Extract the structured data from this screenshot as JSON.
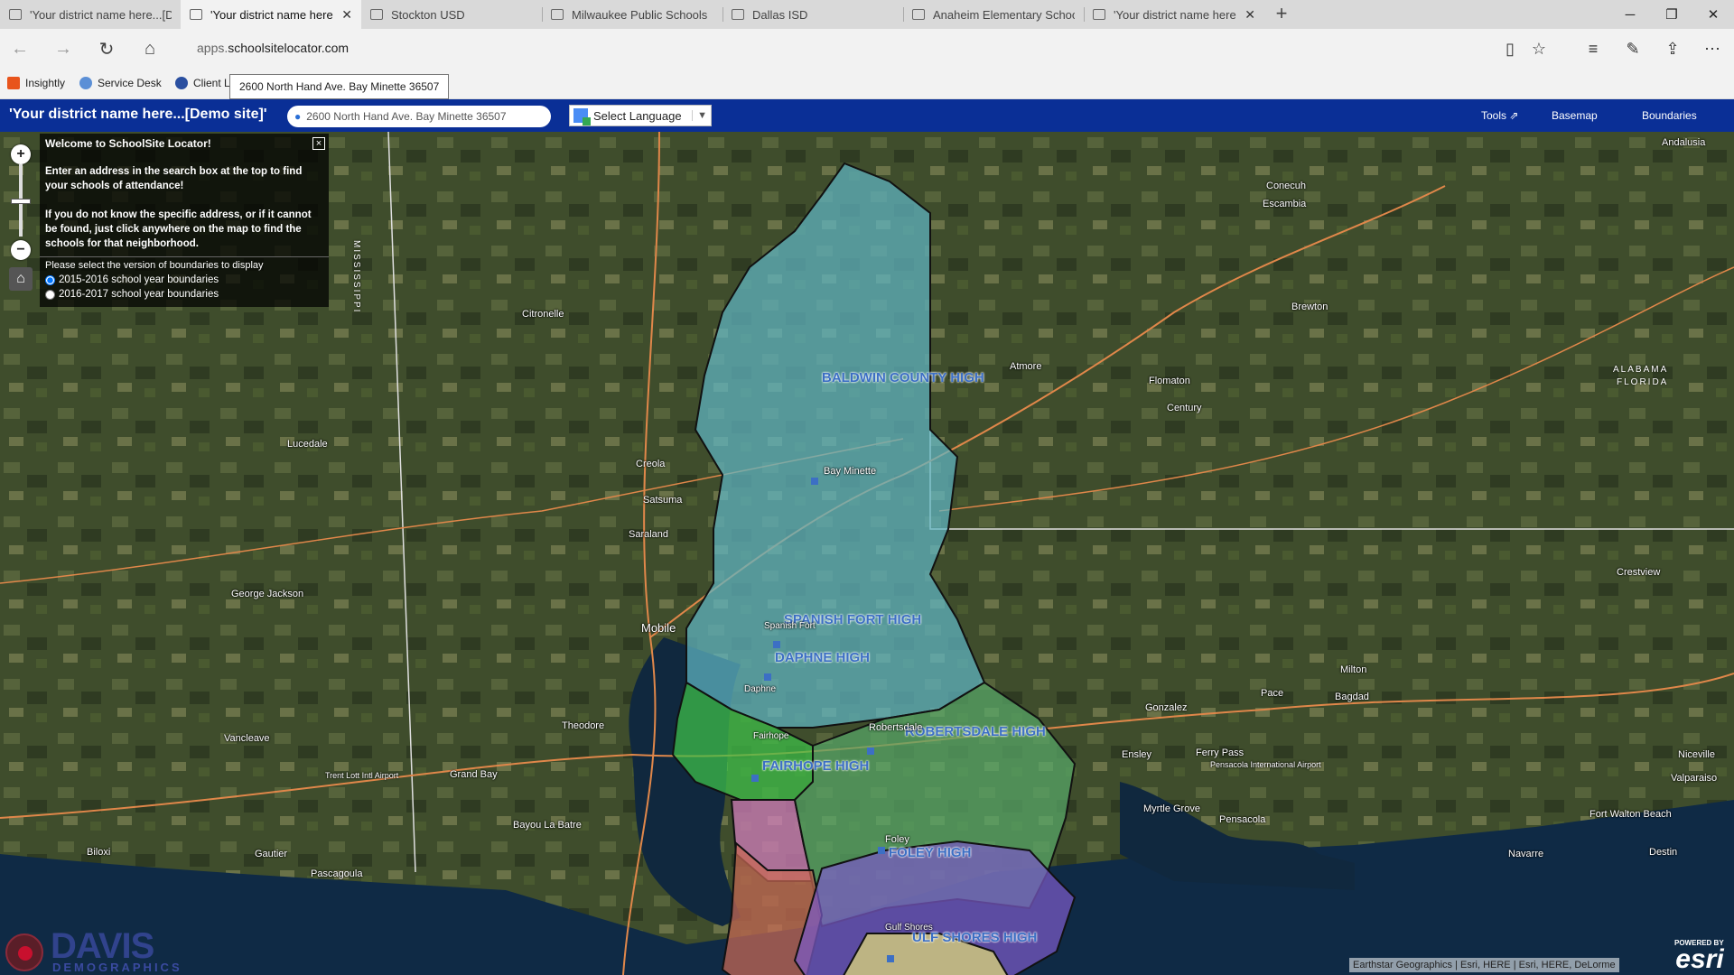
{
  "browser": {
    "tabs": [
      {
        "label": "'Your district name here...[D",
        "active": false,
        "closable": false
      },
      {
        "label": "'Your district name here",
        "active": true,
        "closable": true
      },
      {
        "label": "Stockton USD",
        "active": false,
        "closable": false
      },
      {
        "label": "Milwaukee Public Schools",
        "active": false,
        "closable": false
      },
      {
        "label": "Dallas ISD",
        "active": false,
        "closable": false
      },
      {
        "label": "Anaheim Elementary Schoo",
        "active": false,
        "closable": false
      },
      {
        "label": "'Your district name here",
        "active": false,
        "closable": true
      }
    ],
    "new_tab": "+",
    "url_prefix": "apps.",
    "url_domain": "schoolsitelocator.com",
    "favorites": [
      "Insightly",
      "Service Desk",
      "Client L"
    ],
    "tooltip": "2600 North Hand Ave. Bay Minette 36507"
  },
  "app": {
    "title": "'Your district name here...[Demo site]'",
    "search_value": "2600 North Hand Ave. Bay Minette 36507",
    "language_label": "Select Language",
    "tools_label": "Tools",
    "basemap_label": "Basemap",
    "boundaries_label": "Boundaries"
  },
  "welcome": {
    "title": "Welcome to SchoolSite Locator!",
    "para1": "Enter an address in the search box at the top to find your schools of attendance!",
    "para2": "If you do not know the specific address, or if it cannot be found, just click anywhere on the map to find the schools for that neighborhood.",
    "question": "Please select the version of boundaries to display",
    "options": [
      "2015-2016 school year boundaries",
      "2016-2017 school year boundaries"
    ],
    "selected": 0,
    "close": "×"
  },
  "map": {
    "school_zones": [
      {
        "name": "BALDWIN COUNTY HIGH",
        "color": "#5fb6c4"
      },
      {
        "name": "SPANISH FORT HIGH",
        "color": "#3fc24a"
      },
      {
        "name": "DAPHNE HIGH",
        "color": "#d77fc0"
      },
      {
        "name": "ROBERTSDALE HIGH",
        "color": "#58a868"
      },
      {
        "name": "FAIRHOPE HIGH",
        "color": "#c96a55"
      },
      {
        "name": "FOLEY HIGH",
        "color": "#7a5ac6"
      },
      {
        "name": "GULF SHORES HIGH",
        "color": "#e3dc77"
      }
    ],
    "school_labels": [
      "BALDWIN COUNTY HIGH",
      "SPANISH FORT HIGH",
      "DAPHNE HIGH",
      "ROBERTSDALE HIGH",
      "FAIRHOPE HIGH",
      "FOLEY HIGH",
      "ULF SHORES HIGH"
    ],
    "places": [
      "Mobile",
      "Citronelle",
      "Lucedale",
      "George Jackson",
      "Vancleave",
      "Creola",
      "Satsuma",
      "Saraland",
      "Bay Minette",
      "Atmore",
      "Flomaton",
      "Century",
      "Brewton",
      "Spanish Fort",
      "Daphne",
      "Fairhope",
      "Robertsdale",
      "Foley",
      "Gulf Shores",
      "Theodore",
      "Grand Bay",
      "Bayou La Batre",
      "Gautier",
      "Biloxi",
      "Pascagoula",
      "Gonzalez",
      "Ensley",
      "Pace",
      "Milton",
      "Bagdad",
      "Ferry Pass",
      "Pensacola",
      "Myrtle Grove",
      "Crestview",
      "Niceville",
      "Valparaiso",
      "Destin",
      "Fort Walton Beach",
      "Navarre",
      "Andalusia",
      "Conecuh",
      "Escambia",
      "Trent Lott Intl Airport",
      "Pensacola International Airport"
    ],
    "state_labels": [
      "ALABAMA",
      "FLORIDA",
      "MISSISSIPPI"
    ],
    "attribution": "Earthstar Geographics | Esri, HERE | Esri, HERE, DeLorme",
    "powered_by": "POWERED BY",
    "esri": "esri",
    "logo_name": "DAVIS",
    "logo_sub": "DEMOGRAPHICS"
  }
}
